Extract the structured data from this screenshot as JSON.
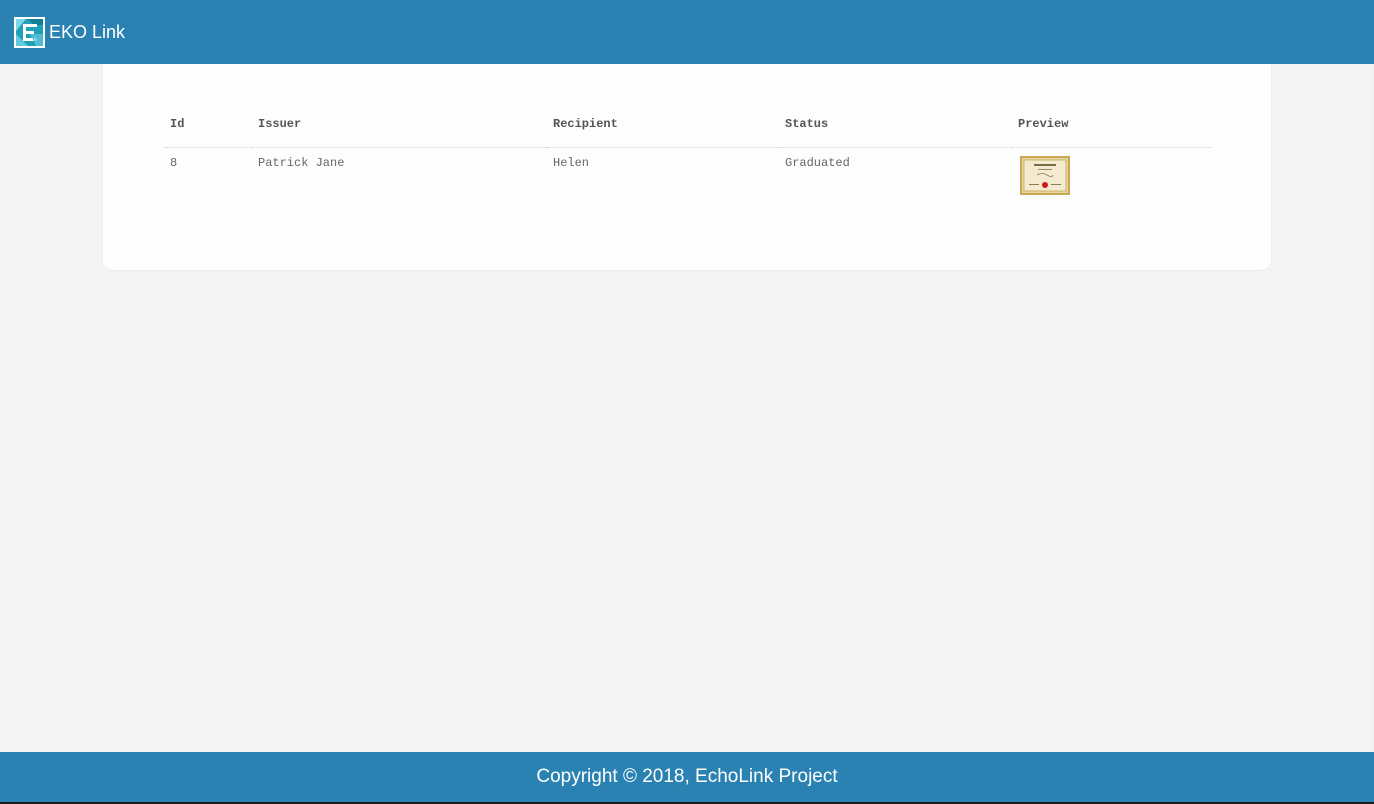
{
  "navbar": {
    "brand": "EKO Link",
    "logo_icon": "eko-logo-icon",
    "background": "#2a82b2"
  },
  "table": {
    "headers": {
      "id": "Id",
      "issuer": "Issuer",
      "recipient": "Recipient",
      "status": "Status",
      "preview": "Preview"
    },
    "rows": [
      {
        "id": "8",
        "issuer": "Patrick Jane",
        "recipient": "Helen",
        "status": "Graduated",
        "preview_icon": "certificate-thumbnail"
      }
    ]
  },
  "footer": {
    "text": "Copyright © 2018, EchoLink Project"
  }
}
